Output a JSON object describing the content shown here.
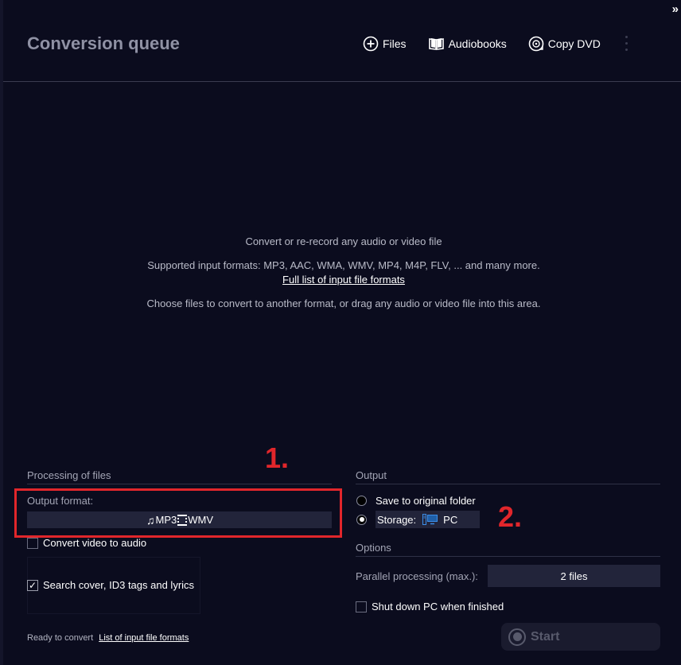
{
  "header": {
    "title": "Conversion queue",
    "collapse_glyph": "»",
    "toolbar": [
      {
        "label": "Files",
        "icon": "plus-circle-icon"
      },
      {
        "label": "Audiobooks",
        "icon": "book-icon"
      },
      {
        "label": "Copy DVD",
        "icon": "disc-icon"
      }
    ]
  },
  "drop_area": {
    "line1": "Convert or re-record any audio or video file",
    "line2": "Supported input formats: MP3, AAC, WMA, WMV, MP4, M4P, FLV, ... and many more.",
    "link": "Full list of input file formats",
    "line4": "Choose files to convert to another format, or drag any audio or video file into this area."
  },
  "processing": {
    "section_label": "Processing of files",
    "output_format_label": "Output format:",
    "format_audio": "MP3",
    "format_video": "WMV",
    "convert_video_label": "Convert video to audio",
    "convert_video_checked": false,
    "search_cover_label": "Search cover, ID3 tags and lyrics",
    "search_cover_checked": true,
    "checkmark": "✓"
  },
  "output": {
    "section_label": "Output",
    "save_original_label": "Save to original folder",
    "storage_label": "Storage:",
    "storage_value": "PC",
    "selected": "storage"
  },
  "options": {
    "section_label": "Options",
    "parallel_label": "Parallel processing (max.):",
    "parallel_value": "2 files",
    "shutdown_label": "Shut down PC when finished",
    "shutdown_checked": false
  },
  "status": {
    "text": "Ready to convert",
    "link": "List of input file formats"
  },
  "start_button": {
    "label": "Start",
    "enabled": false
  },
  "annotations": {
    "one": "1.",
    "two": "2."
  },
  "colors": {
    "background": "#0b0c1e",
    "field": "#22243a",
    "annotation_red": "#e1262b",
    "pc_icon_blue": "#3d8ee8"
  }
}
